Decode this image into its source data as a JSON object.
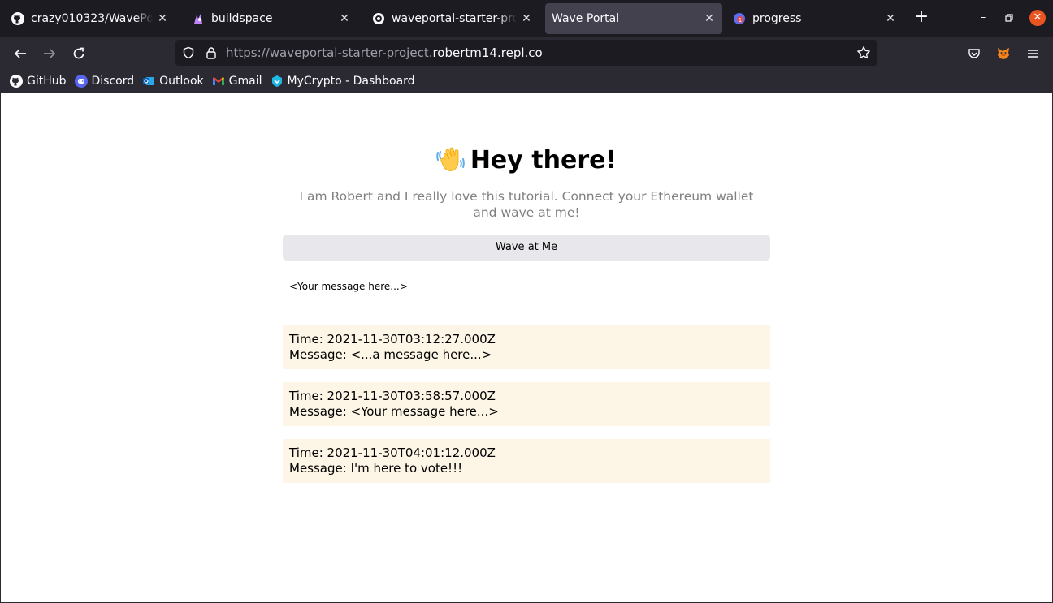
{
  "browser": {
    "tabs": [
      {
        "title": "crazy010323/WavePortal",
        "favicon": "github-icon",
        "active": false
      },
      {
        "title": "buildspace",
        "favicon": "unicorn-icon",
        "active": false
      },
      {
        "title": "waveportal-starter-project",
        "favicon": "replit-icon",
        "active": false
      },
      {
        "title": "Wave Portal",
        "favicon": "none",
        "active": true
      },
      {
        "title": "progress",
        "favicon": "progress-icon",
        "active": false
      }
    ],
    "url_prefix": "https://waveportal-starter-project.",
    "url_host": "robertm14.repl.co",
    "bookmarks": [
      {
        "label": "GitHub",
        "icon": "github-icon"
      },
      {
        "label": "Discord",
        "icon": "discord-icon"
      },
      {
        "label": "Outlook",
        "icon": "outlook-icon"
      },
      {
        "label": "Gmail",
        "icon": "gmail-icon"
      },
      {
        "label": "MyCrypto - Dashboard",
        "icon": "mycrypto-icon"
      }
    ],
    "colors": {
      "toolbar": "#2b2a33",
      "tabstrip": "#1c1b22",
      "close_button": "#e95420"
    }
  },
  "page": {
    "title": "Hey there!",
    "bio": "I am Robert and I really love this tutorial. Connect your Ethereum wallet and wave at me!",
    "wave_button_label": "Wave at Me",
    "message_placeholder": "<Your message here...>",
    "waves": [
      {
        "time": "Time: 2021-11-30T03:12:27.000Z",
        "message": "Message: <...a message here...>"
      },
      {
        "time": "Time: 2021-11-30T03:58:57.000Z",
        "message": "Message: <Your message here...>"
      },
      {
        "time": "Time: 2021-11-30T04:01:12.000Z",
        "message": "Message: I'm here to vote!!!"
      }
    ],
    "colors": {
      "wave_card_bg": "#fdf5e6",
      "button_bg": "#e8e8ec",
      "bio_text": "#808080"
    }
  }
}
